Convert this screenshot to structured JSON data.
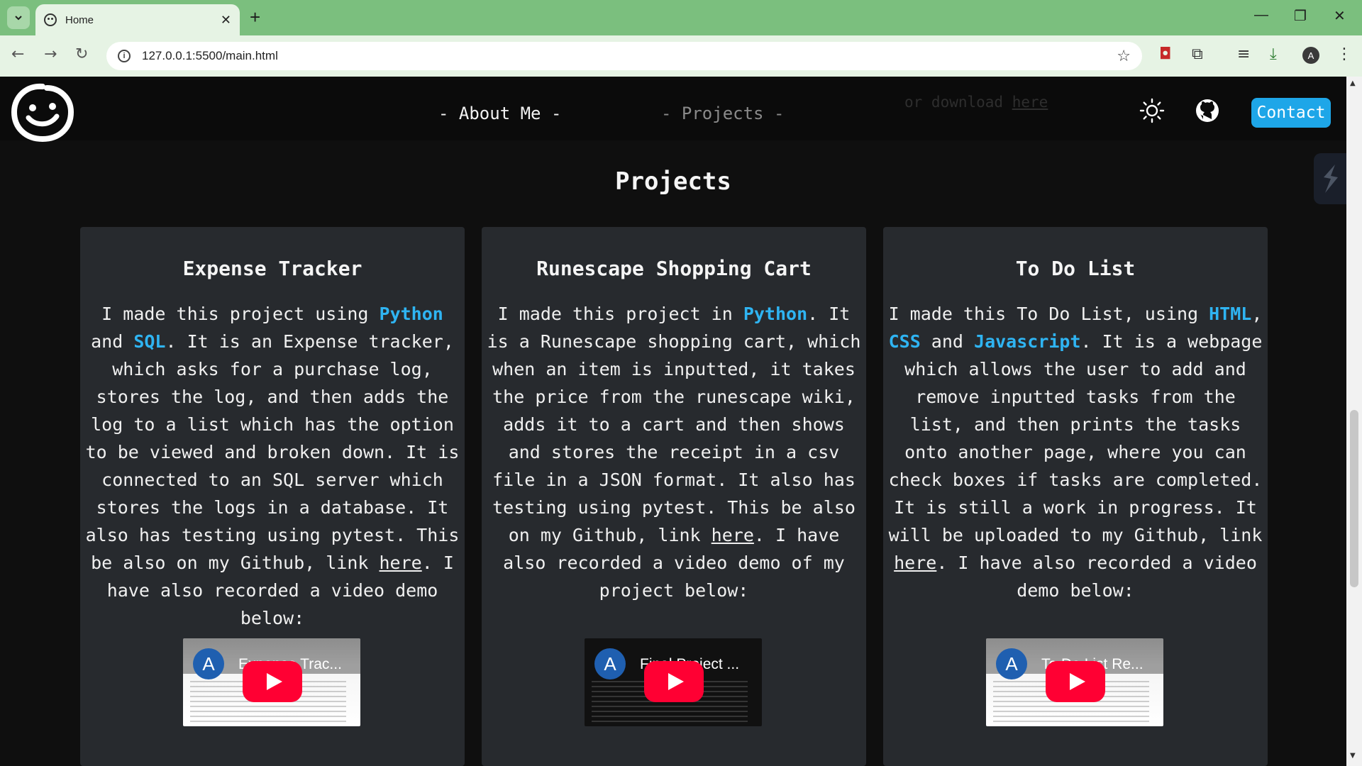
{
  "browser": {
    "tab_title": "Home",
    "tab_close": "✕",
    "new_tab": "+",
    "url": "127.0.0.1:5500/main.html",
    "profile_initial": "A",
    "window_controls": {
      "minimize": "—",
      "restore": "❐",
      "close": "✕"
    }
  },
  "header": {
    "nav": [
      {
        "label": "- About Me -"
      },
      {
        "label": "- Projects -"
      }
    ],
    "ghost_text_prefix": "or download ",
    "ghost_text_link": "here",
    "contact_label": "Contact",
    "icons": {
      "theme": "sun-icon",
      "github": "github-icon"
    }
  },
  "section": {
    "title": "Projects"
  },
  "colors": {
    "accent": "#2fb4f2",
    "contact": "#1ea6e8",
    "card": "#272a2e",
    "page": "#0f0f0f",
    "youtube": "#ff0033",
    "tabstrip": "#7bbf7e"
  },
  "projects": [
    {
      "title": "Expense Tracker",
      "body": [
        "I made this project using ",
        "Python",
        " and ",
        "SQL",
        ". It is an Expense tracker, which asks for a purchase log, stores the log, and then adds the log to a list which has the option to be viewed and broken down. It is connected to an SQL server which stores the logs in a database. It also has testing using pytest. This be also on my Github, link ",
        "here",
        ". I have also recorded a video demo below:"
      ],
      "video": {
        "channel_initial": "A",
        "title": "Expense Trac...",
        "theme": "light"
      }
    },
    {
      "title": "Runescape Shopping Cart",
      "body": [
        "I made this project in ",
        "Python",
        ". It is a Runescape shopping cart, which when an item is inputted, it takes the price from the runescape wiki, adds it to a cart and then shows and stores the receipt in a csv file in a JSON format. It also has testing using pytest. This be also on my Github, link ",
        "here",
        ". I have also recorded a video demo of my project below:"
      ],
      "video": {
        "channel_initial": "A",
        "title": "Final Project ...",
        "theme": "dark"
      }
    },
    {
      "title": "To Do List",
      "body": [
        "I made this To Do List, using ",
        "HTML",
        ", ",
        "CSS",
        " and ",
        "Javascript",
        ". It is a webpage which allows the user to add and remove inputted tasks from the list, and then prints the tasks onto another page, where you can check boxes if tasks are completed. It is still a work in progress. It will be uploaded to my Github, link ",
        "here",
        ". I have also recorded a video demo below:"
      ],
      "video": {
        "channel_initial": "A",
        "title": "To Do List Re...",
        "theme": "light"
      }
    }
  ]
}
